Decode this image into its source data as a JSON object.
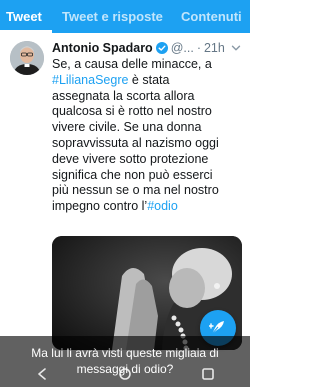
{
  "tabs": [
    {
      "label": "Tweet"
    },
    {
      "label": "Tweet e risposte"
    },
    {
      "label": "Contenuti"
    }
  ],
  "tweet": {
    "author": "Antonio Spadaro",
    "handle": "@...",
    "separator": "·",
    "time": "21h",
    "lines": [
      {
        "parts": [
          "Se, a causa delle minacce, a"
        ]
      },
      {
        "hashtag": "#LilianaSegre",
        "text": " è stata"
      },
      {
        "parts": [
          "assegnata la scorta allora"
        ]
      },
      {
        "parts": [
          "qualcosa si è rotto nel nostro"
        ]
      },
      {
        "parts": [
          "vivere civile. Se una donna"
        ]
      },
      {
        "parts": [
          "sopravvissuta al nazismo oggi"
        ]
      },
      {
        "parts": [
          "deve vivere sotto protezione"
        ]
      },
      {
        "parts": [
          "significa che non può esserci"
        ]
      },
      {
        "parts": [
          "più nessun se o ma nel nostro"
        ]
      },
      {
        "parts": [
          "impegno contro l’"
        ],
        "hashtag_end": "#odio"
      }
    ]
  },
  "subtitle": {
    "line1": "Ma lui li avrà visti queste migliaia di",
    "line2": "messaggi di odio?"
  },
  "icons": {
    "verified": "verified-badge-icon",
    "more": "chevron-down-icon",
    "compose": "compose-feather-icon",
    "back": "back-nav-icon",
    "home": "home-nav-icon",
    "recents": "recents-nav-icon"
  },
  "colors": {
    "brand": "#1da1f2",
    "text": "#14171a",
    "muted": "#657786"
  }
}
